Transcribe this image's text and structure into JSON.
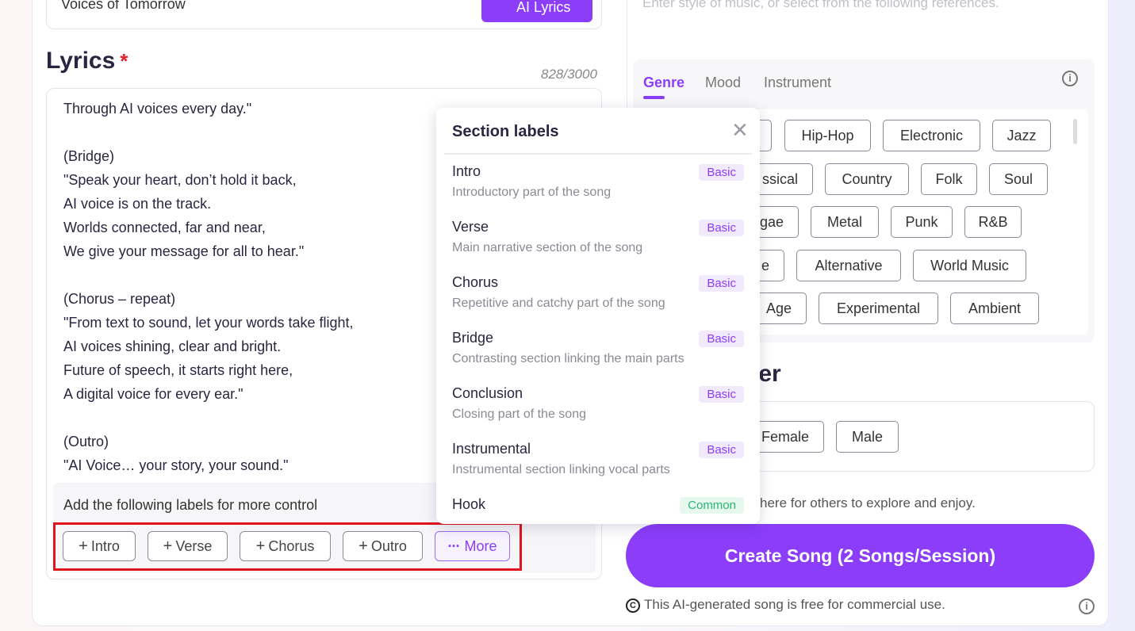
{
  "title_field": {
    "value": "Voices of Tomorrow",
    "ai_button": "AI Lyrics"
  },
  "lyrics": {
    "heading": "Lyrics",
    "required_mark": "*",
    "char_count": "828/3000",
    "text": "Through AI voices every day.\"\n\n(Bridge)\n\"Speak your heart, don’t hold it back,\nAI voice is on the track.\nWorlds connected, far and near,\nWe give your message for all to hear.\"\n\n(Chorus – repeat)\n\"From text to sound, let your words take flight,\nAI voices shining, clear and bright.\nFuture of speech, it starts right here,\nA digital voice for every ear.\"\n\n(Outro)\n\"AI Voice… your story, your sound.\"",
    "labels_hint": "Add the following labels for more control",
    "label_buttons": [
      "Intro",
      "Verse",
      "Chorus",
      "Outro"
    ],
    "more_button": "More"
  },
  "style": {
    "placeholder": "Enter style of music, or select from the following references.",
    "tabs": [
      "Genre",
      "Mood",
      "Instrument"
    ],
    "active_tab": "Genre",
    "genres": [
      "Hip-Hop",
      "Electronic",
      "Jazz",
      "ssical",
      "Country",
      "Folk",
      "Soul",
      "gae",
      "Metal",
      "Punk",
      "R&B",
      "e",
      "Alternative",
      "World Music",
      "Age",
      "Experimental",
      "Ambient"
    ]
  },
  "gender": {
    "heading": "ler",
    "options": [
      "Female",
      "Male"
    ]
  },
  "share_text": "here for others to explore and enjoy.",
  "create_button": "Create Song (2 Songs/Session)",
  "commercial_note": "This AI-generated song is free for commercial use.",
  "section_labels_popup": {
    "title": "Section labels",
    "items": [
      {
        "name": "Intro",
        "desc": "Introductory part of the song",
        "badge": "Basic"
      },
      {
        "name": "Verse",
        "desc": "Main narrative section of the song",
        "badge": "Basic"
      },
      {
        "name": "Chorus",
        "desc": "Repetitive and catchy part of the song",
        "badge": "Basic"
      },
      {
        "name": "Bridge",
        "desc": "Contrasting section linking the main parts",
        "badge": "Basic"
      },
      {
        "name": "Conclusion",
        "desc": "Closing part of the song",
        "badge": "Basic"
      },
      {
        "name": "Instrumental",
        "desc": "Instrumental section linking vocal parts",
        "badge": "Basic"
      },
      {
        "name": "Hook",
        "desc": "",
        "badge": "Common"
      }
    ]
  },
  "colors": {
    "accent": "#8b3dfa",
    "highlight": "#e0141c",
    "common_badge": "#2bb673"
  }
}
